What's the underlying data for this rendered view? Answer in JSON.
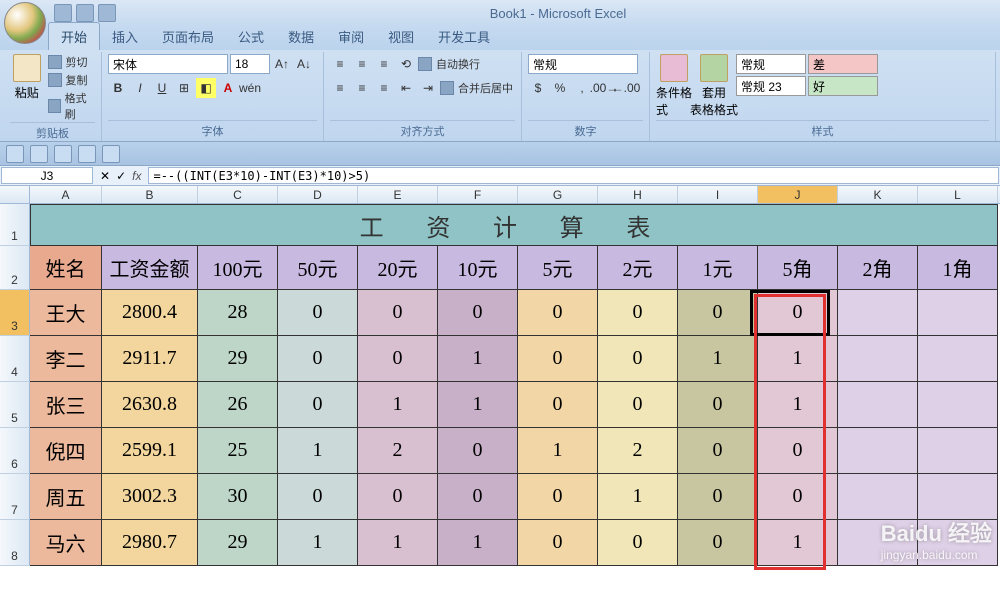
{
  "app": {
    "title": "Book1 - Microsoft Excel"
  },
  "tabs": {
    "items": [
      "开始",
      "插入",
      "页面布局",
      "公式",
      "数据",
      "审阅",
      "视图",
      "开发工具"
    ],
    "active": 0
  },
  "ribbon": {
    "clipboard": {
      "cut": "剪切",
      "copy": "复制",
      "painter": "格式刷",
      "paste": "粘贴",
      "title": "剪贴板"
    },
    "font": {
      "name": "宋体",
      "size": "18",
      "title": "字体"
    },
    "align": {
      "wrap": "自动换行",
      "merge": "合并后居中",
      "title": "对齐方式"
    },
    "number": {
      "format": "常规",
      "title": "数字"
    },
    "styles": {
      "condfmt": "条件格式",
      "tablefmt": "套用\n表格格式",
      "s1": "常规",
      "s2": "常规 23",
      "s3": "差",
      "s4": "好",
      "title": "样式"
    }
  },
  "formula": {
    "name_box": "J3",
    "fx": "fx",
    "text": "=--((INT(E3*10)-INT(E3)*10)>5)"
  },
  "columns": [
    "A",
    "B",
    "C",
    "D",
    "E",
    "F",
    "G",
    "H",
    "I",
    "J",
    "K",
    "L"
  ],
  "sheet_title": "工 资 计 算 表",
  "headers": [
    "姓名",
    "工资金额",
    "100元",
    "50元",
    "20元",
    "10元",
    "5元",
    "2元",
    "1元",
    "5角",
    "2角",
    "1角"
  ],
  "chart_data": {
    "type": "table",
    "columns": [
      "姓名",
      "工资金额",
      "100元",
      "50元",
      "20元",
      "10元",
      "5元",
      "2元",
      "1元",
      "5角",
      "2角",
      "1角"
    ],
    "rows": [
      {
        "姓名": "王大",
        "工资金额": "2800.4",
        "100元": 28,
        "50元": 0,
        "20元": 0,
        "10元": 0,
        "5元": 0,
        "2元": 0,
        "1元": 0,
        "5角": 0,
        "2角": "",
        "1角": ""
      },
      {
        "姓名": "李二",
        "工资金额": "2911.7",
        "100元": 29,
        "50元": 0,
        "20元": 0,
        "10元": 1,
        "5元": 0,
        "2元": 0,
        "1元": 1,
        "5角": 1,
        "2角": "",
        "1角": ""
      },
      {
        "姓名": "张三",
        "工资金额": "2630.8",
        "100元": 26,
        "50元": 0,
        "20元": 1,
        "10元": 1,
        "5元": 0,
        "2元": 0,
        "1元": 0,
        "5角": 1,
        "2角": "",
        "1角": ""
      },
      {
        "姓名": "倪四",
        "工资金额": "2599.1",
        "100元": 25,
        "50元": 1,
        "20元": 2,
        "10元": 0,
        "5元": 1,
        "2元": 2,
        "1元": 0,
        "5角": 0,
        "2角": "",
        "1角": ""
      },
      {
        "姓名": "周五",
        "工资金额": "3002.3",
        "100元": 30,
        "50元": 0,
        "20元": 0,
        "10元": 0,
        "5元": 0,
        "2元": 1,
        "1元": 0,
        "5角": 0,
        "2角": "",
        "1角": ""
      },
      {
        "姓名": "马六",
        "工资金额": "2980.7",
        "100元": 29,
        "50元": 1,
        "20元": 1,
        "10元": 1,
        "5元": 0,
        "2元": 0,
        "1元": 0,
        "5角": 1,
        "2角": "",
        "1角": ""
      }
    ]
  },
  "watermark": {
    "brand": "Baidu 经验",
    "url": "jingyan.baidu.com"
  }
}
